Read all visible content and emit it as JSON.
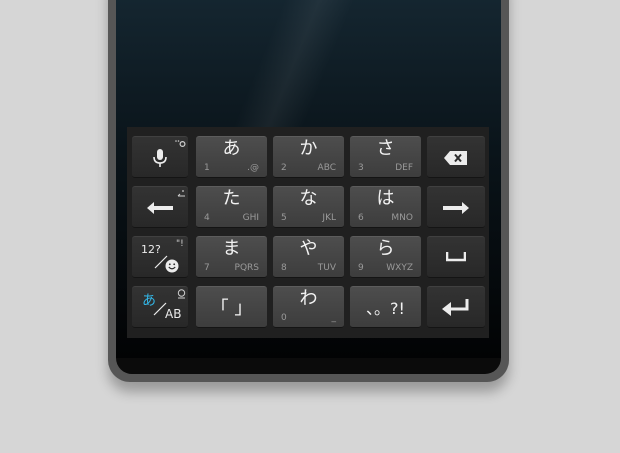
{
  "keyboard": {
    "keys": [
      {
        "main": "あ",
        "num": "1",
        "sub": ".@"
      },
      {
        "main": "か",
        "num": "2",
        "sub": "ABC"
      },
      {
        "main": "さ",
        "num": "3",
        "sub": "DEF"
      },
      {
        "main": "た",
        "num": "4",
        "sub": "GHI"
      },
      {
        "main": "な",
        "num": "5",
        "sub": "JKL"
      },
      {
        "main": "は",
        "num": "6",
        "sub": "MNO"
      },
      {
        "main": "ま",
        "num": "7",
        "sub": "PQRS"
      },
      {
        "main": "や",
        "num": "8",
        "sub": "TUV"
      },
      {
        "main": "ら",
        "num": "9",
        "sub": "WXYZ"
      },
      {
        "main": "「 」"
      },
      {
        "main": "わ",
        "num": "0",
        "sub": "_"
      },
      {
        "main": "、。?!"
      }
    ],
    "mode_key": {
      "top": "12?",
      "emoji_hint": "\"!"
    },
    "input_mode_key": {
      "hiragana": "あ",
      "alpha": "AB"
    },
    "accent_color": "#33b5e5"
  }
}
